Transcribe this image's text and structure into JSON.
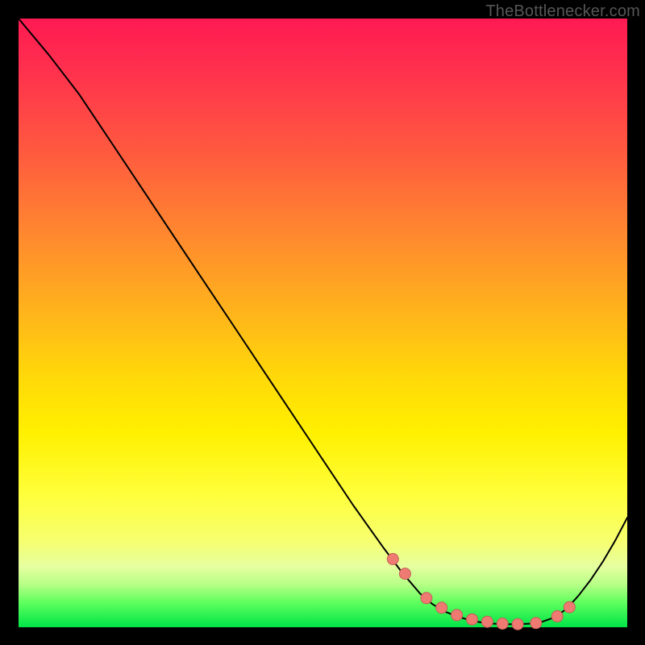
{
  "watermark": "TheBottlenecker.com",
  "chart_data": {
    "type": "line",
    "title": "",
    "xlabel": "",
    "ylabel": "",
    "xlim": [
      0,
      100
    ],
    "ylim": [
      0,
      100
    ],
    "grid": false,
    "series": [
      {
        "name": "curve",
        "x": [
          0,
          5,
          10,
          15,
          20,
          25,
          30,
          35,
          40,
          45,
          50,
          55,
          60,
          63,
          66,
          68,
          70,
          72,
          74,
          76,
          78,
          80,
          82,
          84,
          86,
          88,
          90,
          92,
          94,
          96,
          98,
          100
        ],
        "y": [
          100,
          94,
          87.5,
          80,
          72.5,
          65,
          57.5,
          50,
          42.5,
          35,
          27.5,
          20,
          13,
          9,
          5.5,
          3.8,
          2.6,
          1.8,
          1.2,
          0.8,
          0.6,
          0.5,
          0.5,
          0.6,
          0.9,
          1.6,
          3.0,
          5.2,
          7.8,
          10.8,
          14.2,
          18.0
        ]
      }
    ],
    "markers": {
      "name": "highlight-dots",
      "x": [
        61.5,
        63.5,
        67,
        69.5,
        72,
        74.5,
        77,
        79.5,
        82,
        85,
        88.5,
        90.5
      ],
      "y": [
        11.2,
        8.8,
        4.8,
        3.2,
        2.0,
        1.3,
        0.9,
        0.6,
        0.5,
        0.7,
        1.8,
        3.3
      ]
    }
  }
}
